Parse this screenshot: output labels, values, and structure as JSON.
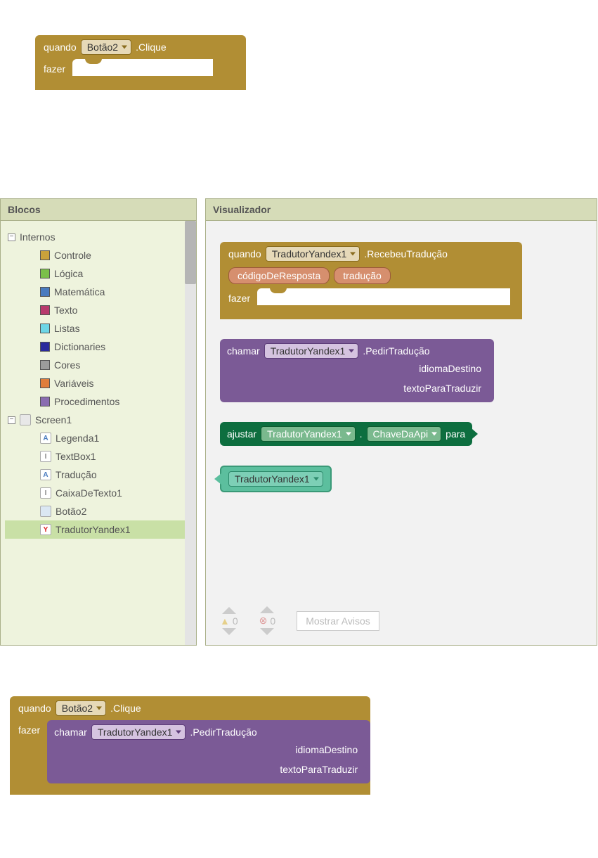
{
  "section1": {
    "when": "quando",
    "component": "Botão2",
    "event": ".Clique",
    "do": "fazer"
  },
  "panels": {
    "blocks_header": "Blocos",
    "viewer_header": "Visualizador",
    "tree": {
      "root1": "Internos",
      "builtins": [
        {
          "label": "Controle",
          "color": "#c9a13b"
        },
        {
          "label": "Lógica",
          "color": "#7bbf4a"
        },
        {
          "label": "Matemática",
          "color": "#4a7bbf"
        },
        {
          "label": "Texto",
          "color": "#b83a6d"
        },
        {
          "label": "Listas",
          "color": "#6dd6e6"
        },
        {
          "label": "Dictionaries",
          "color": "#2a2a9c"
        },
        {
          "label": "Cores",
          "color": "#9c9c9c"
        },
        {
          "label": "Variáveis",
          "color": "#e07d3a"
        },
        {
          "label": "Procedimentos",
          "color": "#8a6db0"
        }
      ],
      "root2": "Screen1",
      "components": [
        {
          "label": "Legenda1",
          "glyph": "A",
          "glyphColor": "#4a7bbf"
        },
        {
          "label": "TextBox1",
          "glyph": "I",
          "glyphColor": "#888"
        },
        {
          "label": "Tradução",
          "glyph": "A",
          "glyphColor": "#4a7bbf"
        },
        {
          "label": "CaixaDeTexto1",
          "glyph": "I",
          "glyphColor": "#888"
        },
        {
          "label": "Botão2",
          "glyph": "",
          "glyphColor": "#b0c4de"
        },
        {
          "label": "TradutorYandex1",
          "glyph": "Y",
          "glyphColor": "#d22",
          "selected": true
        }
      ]
    },
    "canvas": {
      "event": {
        "when": "quando",
        "component": "TradutorYandex1",
        "event": ".RecebeuTradução",
        "param1": "códigoDeResposta",
        "param2": "tradução",
        "do": "fazer"
      },
      "call": {
        "verb": "chamar",
        "component": "TradutorYandex1",
        "method": ".PedirTradução",
        "arg1": "idiomaDestino",
        "arg2": "textoParaTraduzir"
      },
      "setter": {
        "verb": "ajustar",
        "component": "TradutorYandex1",
        "dot": ".",
        "prop": "ChaveDaApi",
        "to": "para"
      },
      "getter": {
        "component": "TradutorYandex1"
      }
    },
    "status": {
      "warn_count": "0",
      "err_count": "0",
      "show_warnings": "Mostrar Avisos"
    }
  },
  "section3": {
    "when": "quando",
    "component": "Botão2",
    "event": ".Clique",
    "do": "fazer",
    "call": {
      "verb": "chamar",
      "component": "TradutorYandex1",
      "method": ".PedirTradução",
      "arg1": "idiomaDestino",
      "arg2": "textoParaTraduzir"
    }
  }
}
